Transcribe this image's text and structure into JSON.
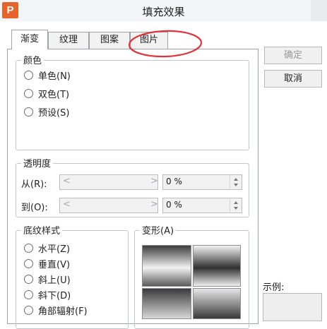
{
  "window": {
    "title": "填充效果",
    "app_icon_letter": "P"
  },
  "tabs": [
    {
      "label": "渐变",
      "active": true
    },
    {
      "label": "纹理",
      "active": false
    },
    {
      "label": "图案",
      "active": false
    },
    {
      "label": "图片",
      "active": false
    }
  ],
  "color_group": {
    "legend": "颜色",
    "options": [
      {
        "label": "单色(N)"
      },
      {
        "label": "双色(T)"
      },
      {
        "label": "预设(S)"
      }
    ]
  },
  "transparency_group": {
    "legend": "透明度",
    "from_label": "从(R):",
    "to_label": "到(O):",
    "left_arrow": "<",
    "right_arrow": ">",
    "from_value": "0 %",
    "to_value": "0 %"
  },
  "shading_group": {
    "legend": "底纹样式",
    "options": [
      {
        "label": "水平(Z)"
      },
      {
        "label": "垂直(V)"
      },
      {
        "label": "斜上(U)"
      },
      {
        "label": "斜下(D)"
      },
      {
        "label": "角部辐射(F)"
      }
    ]
  },
  "variants_group": {
    "legend": "变形(A)"
  },
  "buttons": {
    "ok": "确定",
    "cancel": "取消"
  },
  "sample_label": "示例:",
  "colors": {
    "annotation": "#e0343a",
    "app_icon": "#e8632a"
  }
}
